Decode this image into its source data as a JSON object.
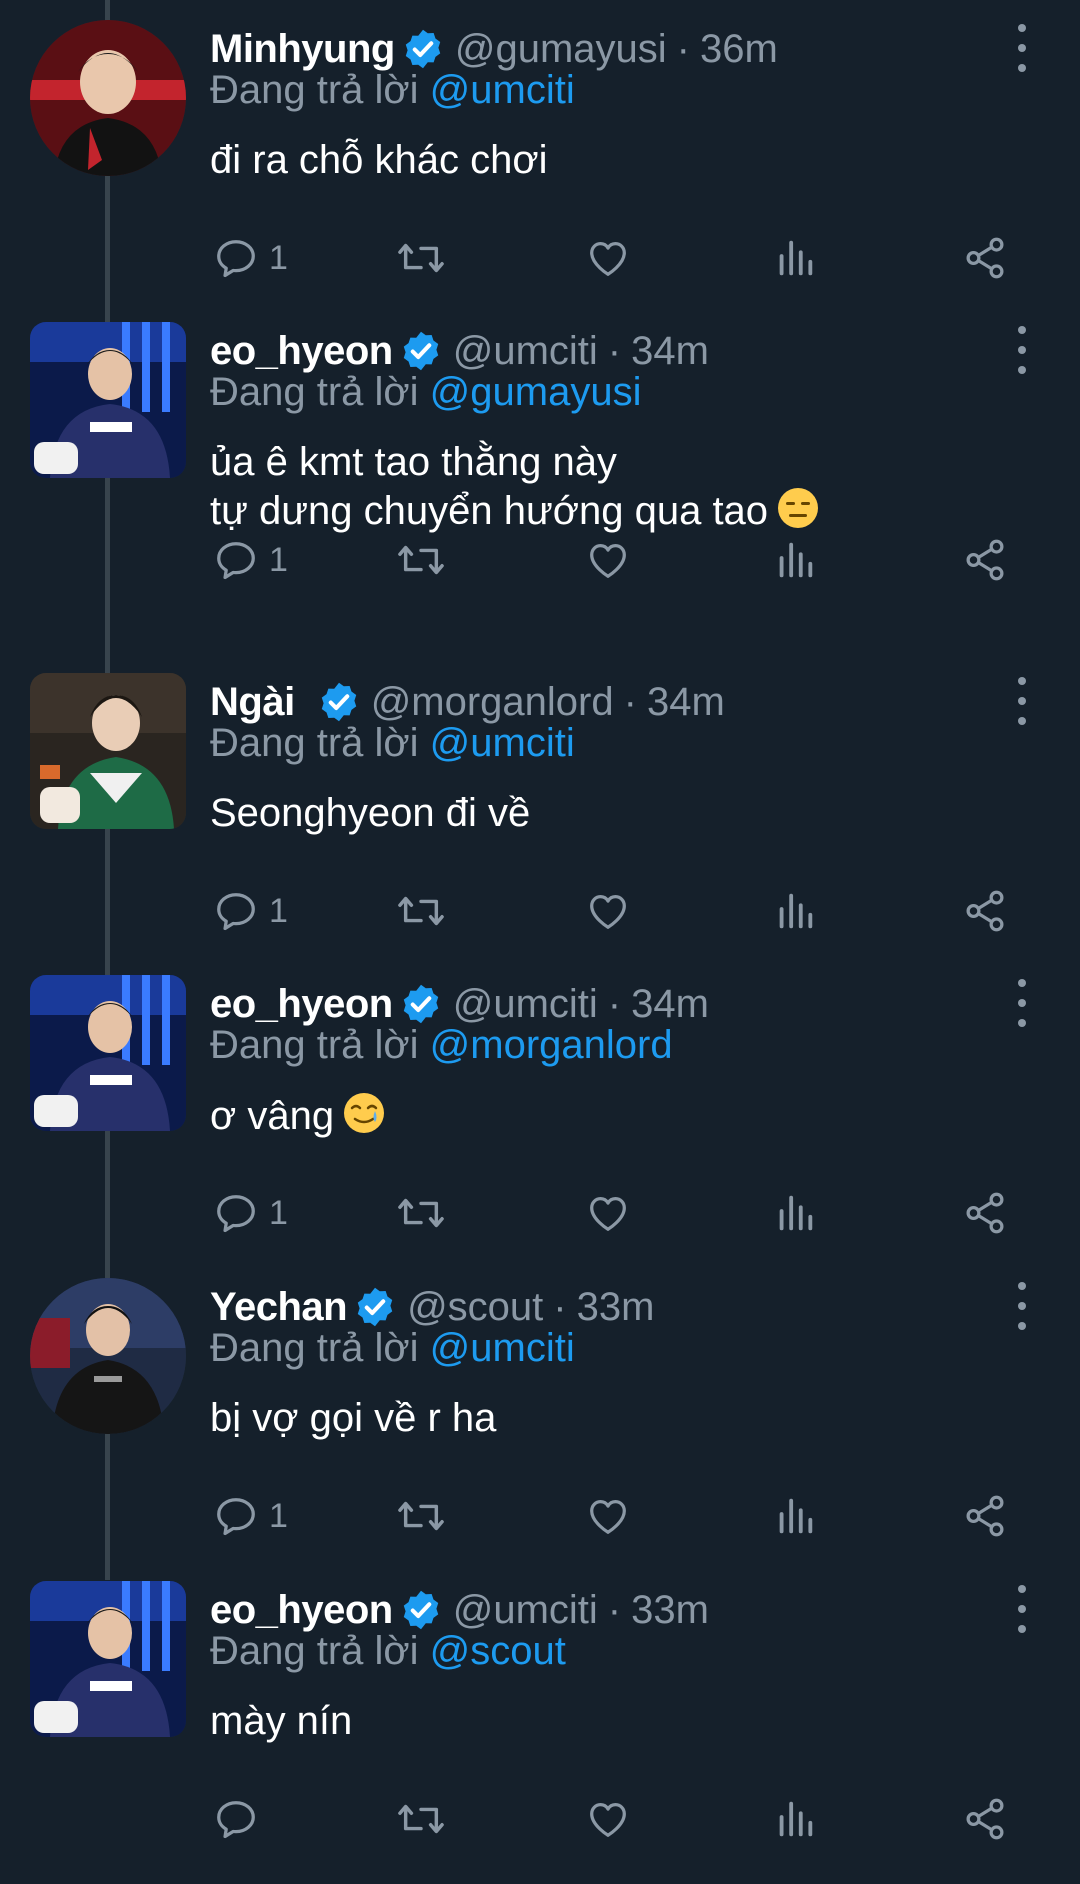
{
  "colors": {
    "background": "#15202b",
    "primary_text": "#ffffff",
    "secondary_text": "#8b98a5",
    "accent": "#1d9bf0",
    "thread_line": "#38444d"
  },
  "icons": {
    "verified": "verified-badge-icon",
    "more": "more-vertical-icon",
    "reply": "reply-bubble-icon",
    "retweet": "retweet-icon",
    "like": "heart-icon",
    "views": "analytics-bars-icon",
    "share": "share-icon"
  },
  "tweets": [
    {
      "name": "Minhyung",
      "handle": "@gumayusi",
      "separator": "·",
      "time": "36m",
      "replying_prefix": "Đang trả lời",
      "replying_to": "@umciti",
      "text_lines": [
        "đi ra chỗ khác chơi"
      ],
      "reply_count": "1"
    },
    {
      "name": "eo_hyeon",
      "handle": "@umciti",
      "separator": "·",
      "time": "34m",
      "replying_prefix": "Đang trả lời",
      "replying_to": "@gumayusi",
      "text_lines": [
        "ủa ê kmt tao thằng này",
        "tự dưng chuyển hướng qua tao"
      ],
      "emoji": "expressionless-face",
      "reply_count": "1"
    },
    {
      "name": "Ngài",
      "handle": "@morganlord",
      "separator": "·",
      "time": "34m",
      "replying_prefix": "Đang trả lời",
      "replying_to": "@umciti",
      "text_lines": [
        "Seonghyeon đi về"
      ],
      "reply_count": "1"
    },
    {
      "name": "eo_hyeon",
      "handle": "@umciti",
      "separator": "·",
      "time": "34m",
      "replying_prefix": "Đang trả lời",
      "replying_to": "@morganlord",
      "text_lines": [
        "ơ vâng"
      ],
      "emoji": "smiling-face-with-tear",
      "reply_count": "1"
    },
    {
      "name": "Yechan",
      "handle": "@scout",
      "separator": "·",
      "time": "33m",
      "replying_prefix": "Đang trả lời",
      "replying_to": "@umciti",
      "text_lines": [
        "bị vợ gọi về r ha"
      ],
      "reply_count": "1"
    },
    {
      "name": "eo_hyeon",
      "handle": "@umciti",
      "separator": "·",
      "time": "33m",
      "replying_prefix": "Đang trả lời",
      "replying_to": "@scout",
      "text_lines": [
        "mày nín"
      ],
      "reply_count": ""
    }
  ]
}
